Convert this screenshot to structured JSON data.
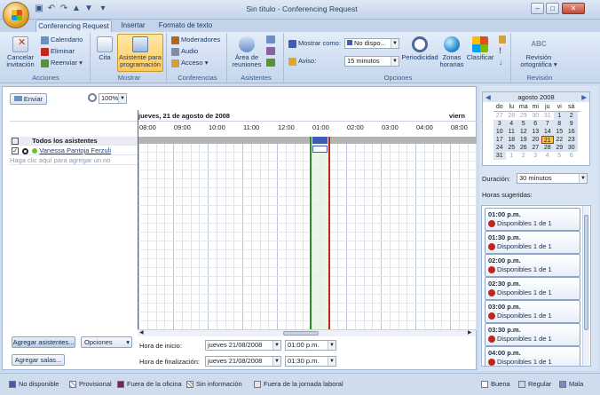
{
  "window": {
    "title": "Sin título - Conferencing Request"
  },
  "ribbon_tabs": [
    "Conferencing Request",
    "Insertar",
    "Formato de texto"
  ],
  "ribbon": {
    "acciones": {
      "label": "Acciones",
      "cancel": "Cancelar invitación",
      "calendar": "Calendario",
      "delete": "Eliminar",
      "forward": "Reenviar"
    },
    "mostrar": {
      "label": "Mostrar",
      "cita": "Cita",
      "asistente": "Asistente para programación"
    },
    "conferencias": {
      "label": "Conferencias",
      "moderadores": "Moderadores",
      "audio": "Audio",
      "acceso": "Acceso"
    },
    "asistentes": {
      "label": "Asistentes",
      "area": "Área de reuniones"
    },
    "opciones": {
      "label": "Opciones",
      "mostrar_como_label": "Mostrar como:",
      "mostrar_como_value": "No dispo...",
      "aviso_label": "Aviso:",
      "aviso_value": "15 minutos",
      "periodicidad": "Periodicidad",
      "zonas": "Zonas horarias",
      "clasificar": "Clasificar"
    },
    "revision": {
      "label": "Revisión",
      "ortografia": "Revisión ortográfica"
    }
  },
  "toolbar": {
    "send": "Enviar",
    "zoom": "100%"
  },
  "schedule": {
    "date_header": "jueves, 21 de agosto de 2008",
    "next_header": "viern",
    "hours": [
      "08:00",
      "09:00",
      "10:00",
      "11:00",
      "12:00",
      "01:00",
      "02:00",
      "03:00",
      "04:00",
      "08:00"
    ],
    "all_attendees": "Todos los asistentes",
    "attendee": "Vanessa Pantoja Ferzuli",
    "add_placeholder": "Haga clic aquí para agregar un no"
  },
  "bottom": {
    "add_attendees": "Agregar asistentes...",
    "options": "Opciones",
    "add_rooms": "Agregar salas...",
    "start_label": "Hora de inicio:",
    "start_date": "jueves 21/08/2008",
    "start_time": "01:00 p.m.",
    "end_label": "Hora de finalización:",
    "end_date": "jueves 21/08/2008",
    "end_time": "01:30 p.m."
  },
  "calendar": {
    "month": "agosto 2008",
    "weekdays": [
      "do",
      "lu",
      "ma",
      "mi",
      "ju",
      "vi",
      "sá"
    ],
    "weeks": [
      [
        "27",
        "28",
        "29",
        "30",
        "31",
        "1",
        "2"
      ],
      [
        "3",
        "4",
        "5",
        "6",
        "7",
        "8",
        "9"
      ],
      [
        "10",
        "11",
        "12",
        "13",
        "14",
        "15",
        "16"
      ],
      [
        "17",
        "18",
        "19",
        "20",
        "21",
        "22",
        "23"
      ],
      [
        "24",
        "25",
        "26",
        "27",
        "28",
        "29",
        "30"
      ],
      [
        "31",
        "1",
        "2",
        "3",
        "4",
        "5",
        "6"
      ]
    ],
    "selected_day": "21"
  },
  "duration": {
    "label": "Duración:",
    "value": "30 minutos"
  },
  "suggestions": {
    "label": "Horas sugeridas:",
    "items": [
      {
        "time": "01:00 p.m.",
        "availability": "Disponibles 1 de 1"
      },
      {
        "time": "01:30 p.m.",
        "availability": "Disponibles 1 de 1"
      },
      {
        "time": "02:00 p.m.",
        "availability": "Disponibles 1 de 1"
      },
      {
        "time": "02:30 p.m.",
        "availability": "Disponibles 1 de 1"
      },
      {
        "time": "03:00 p.m.",
        "availability": "Disponibles 1 de 1"
      },
      {
        "time": "03:30 p.m.",
        "availability": "Disponibles 1 de 1"
      },
      {
        "time": "04:00 p.m.",
        "availability": "Disponibles 1 de 1"
      }
    ]
  },
  "legend": {
    "busy": "No disponible",
    "tentative": "Provisional",
    "out": "Fuera de la oficina",
    "noinfo": "Sin información",
    "outside": "Fuera de la jornada laboral",
    "good": "Buena",
    "fair": "Regular",
    "poor": "Mala"
  },
  "colors": {
    "busy": "#3b5db5",
    "tentative": "#a6b8e0",
    "out": "#7a1f6f",
    "selected": "#f6c54b"
  }
}
